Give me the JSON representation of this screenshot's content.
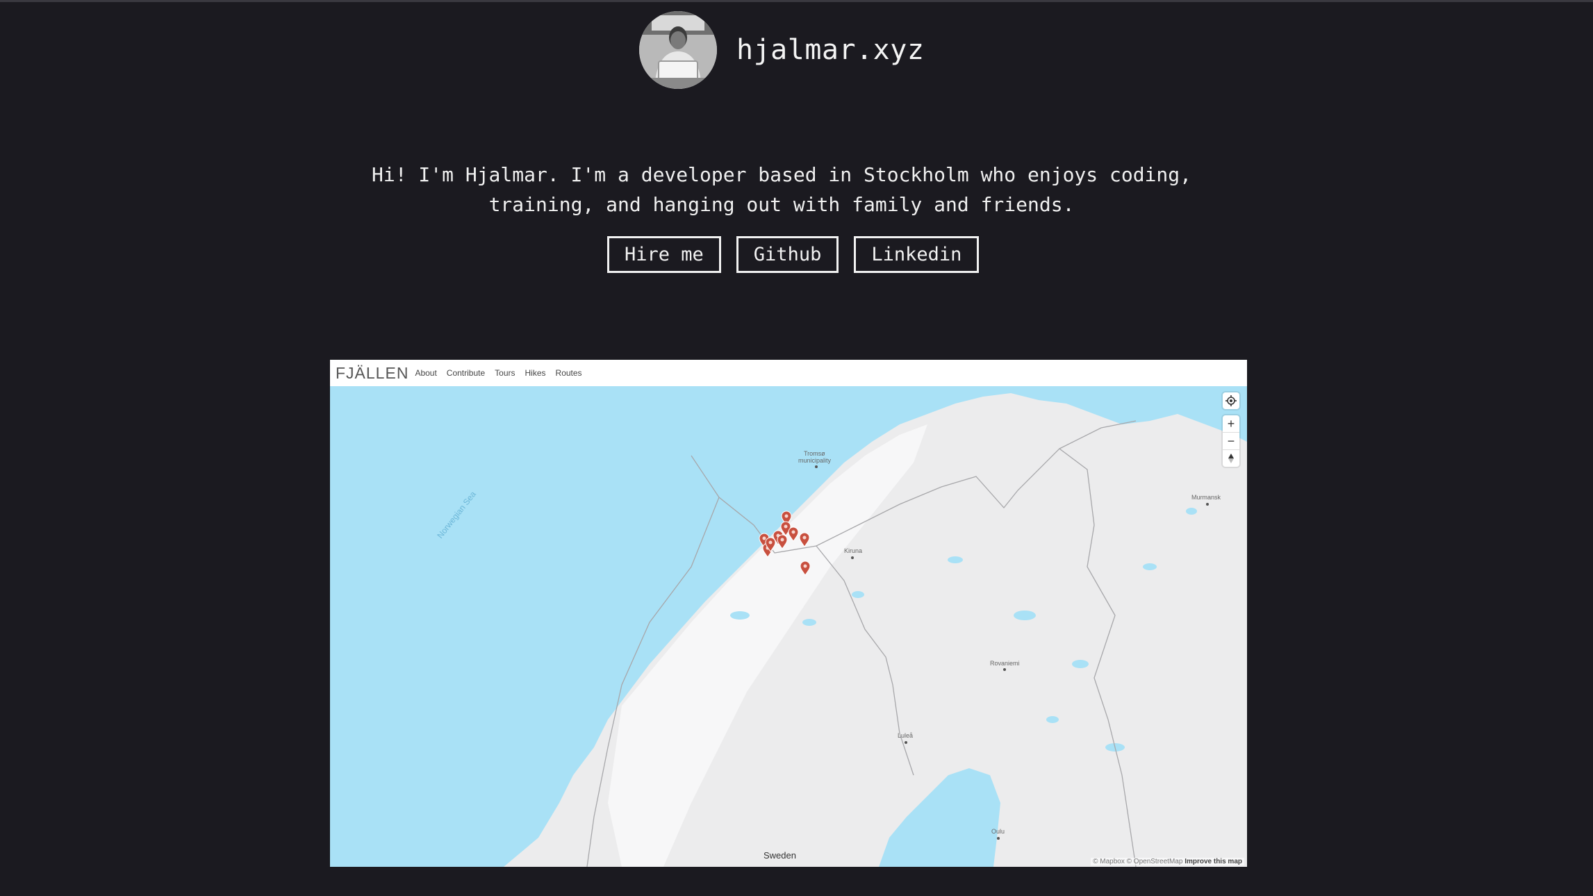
{
  "site": {
    "title": "hjalmar.xyz",
    "intro_line1": "Hi! I'm Hjalmar. I'm a developer based in Stockholm who enjoys coding,",
    "intro_line2": "training, and hanging out with family and friends."
  },
  "links": [
    {
      "label": "Hire me"
    },
    {
      "label": "Github"
    },
    {
      "label": "Linkedin"
    }
  ],
  "embed": {
    "logo": "FJÄLLEN",
    "nav": [
      "About",
      "Contribute",
      "Tours",
      "Hikes",
      "Routes"
    ],
    "map_labels": {
      "sea": "Norwegian Sea",
      "tromso": "Tromsø",
      "tromso_sub": "municipality",
      "kiruna": "Kiruna",
      "murmansk": "Murmansk",
      "rovaniemi": "Rovaniemi",
      "lulea": "Luleå",
      "oulu": "Oulu",
      "sweden": "Sweden"
    },
    "controls": {
      "locate": "locate-icon",
      "zoom_in": "+",
      "zoom_out": "−",
      "compass": "compass-icon"
    },
    "attribution": {
      "mapbox": "© Mapbox",
      "osm": "© OpenStreetMap",
      "improve": "Improve this map"
    }
  },
  "colors": {
    "background": "#1b1a20",
    "sea": "#a9e1f6",
    "land": "#ececed",
    "marker": "#c8503f"
  }
}
